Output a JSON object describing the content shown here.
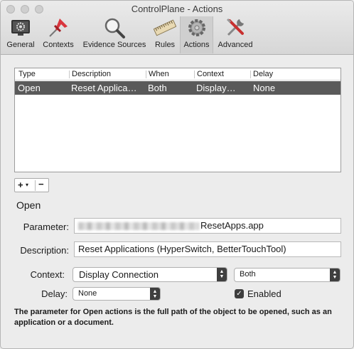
{
  "window": {
    "title": "ControlPlane - Actions"
  },
  "toolbar": {
    "items": [
      {
        "label": "General",
        "icon": "monitor-gear-icon"
      },
      {
        "label": "Contexts",
        "icon": "pushpin-icon"
      },
      {
        "label": "Evidence Sources",
        "icon": "magnifier-icon"
      },
      {
        "label": "Rules",
        "icon": "ruler-icon"
      },
      {
        "label": "Actions",
        "icon": "gear-icon",
        "selected": true
      },
      {
        "label": "Advanced",
        "icon": "tools-icon"
      }
    ]
  },
  "table": {
    "columns": [
      "Type",
      "Description",
      "When",
      "Context",
      "Delay"
    ],
    "rows": [
      {
        "type": "Open",
        "description": "Reset Applica…",
        "when": "Both",
        "context": "Display…",
        "delay": "None"
      }
    ]
  },
  "buttons": {
    "add": "+",
    "add_menu": "▾",
    "remove": "−"
  },
  "detail": {
    "heading": "Open",
    "parameter_label": "Parameter:",
    "parameter_value": "ResetApps.app",
    "description_label": "Description:",
    "description_value": "Reset Applications (HyperSwitch, BetterTouchTool)",
    "context_label": "Context:",
    "context_value": "Display Connection",
    "when_value": "Both",
    "delay_label": "Delay:",
    "delay_value": "None",
    "enabled_label": "Enabled",
    "enabled": true,
    "help_text": "The parameter for Open actions is the full path of the object to be opened, such as an application or a document."
  },
  "colors": {
    "selection": "#5a5a5a",
    "accent": "#3d3d3d"
  }
}
